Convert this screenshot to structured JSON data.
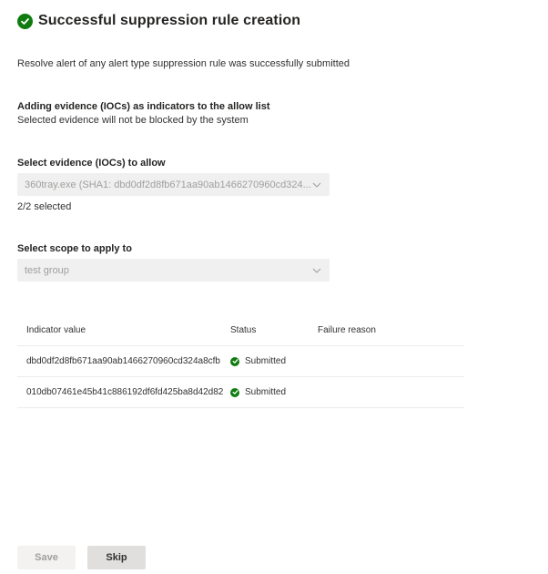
{
  "header": {
    "title": "Successful suppression rule creation",
    "icon": "check-circle-icon",
    "icon_color": "#107c10"
  },
  "subtitle": "Resolve alert of any alert type suppression rule was successfully submitted",
  "allow_list_section": {
    "heading": "Adding evidence (IOCs) as indicators to the allow list",
    "description": "Selected evidence will not be blocked by the system"
  },
  "evidence_select": {
    "label": "Select evidence (IOCs) to allow",
    "value": "360tray.exe (SHA1: dbd0df2d8fb671aa90ab1466270960cd324...",
    "selected_count": "2/2 selected"
  },
  "scope_select": {
    "label": "Select scope to apply to",
    "value": "test group"
  },
  "table": {
    "columns": [
      "Indicator value",
      "Status",
      "Failure reason"
    ],
    "rows": [
      {
        "indicator": "dbd0df2d8fb671aa90ab1466270960cd324a8cfb",
        "status": "Submitted",
        "failure_reason": ""
      },
      {
        "indicator": "010db07461e45b41c886192df6fd425ba8d42d82",
        "status": "Submitted",
        "failure_reason": ""
      }
    ]
  },
  "footer": {
    "save_label": "Save",
    "skip_label": "Skip"
  }
}
